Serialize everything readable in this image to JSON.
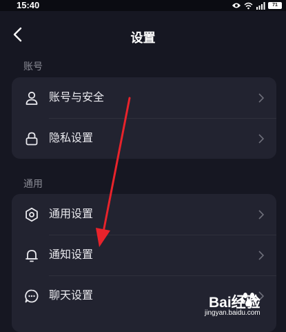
{
  "status_bar": {
    "time": "15:40",
    "battery": "71"
  },
  "nav": {
    "title": "设置"
  },
  "sections": [
    {
      "label": "账号",
      "items": [
        {
          "label": "账号与安全",
          "icon": "user-icon"
        },
        {
          "label": "隐私设置",
          "icon": "lock-icon"
        }
      ]
    },
    {
      "label": "通用",
      "items": [
        {
          "label": "通用设置",
          "icon": "gear-icon"
        },
        {
          "label": "通知设置",
          "icon": "bell-icon"
        },
        {
          "label": "聊天设置",
          "icon": "chat-icon"
        }
      ]
    }
  ],
  "watermark": {
    "brand": "Bai经验",
    "url": "jingyan.baidu.com"
  },
  "colors": {
    "background": "#161722",
    "card": "#222330",
    "annotation_arrow": "#e8232b"
  }
}
